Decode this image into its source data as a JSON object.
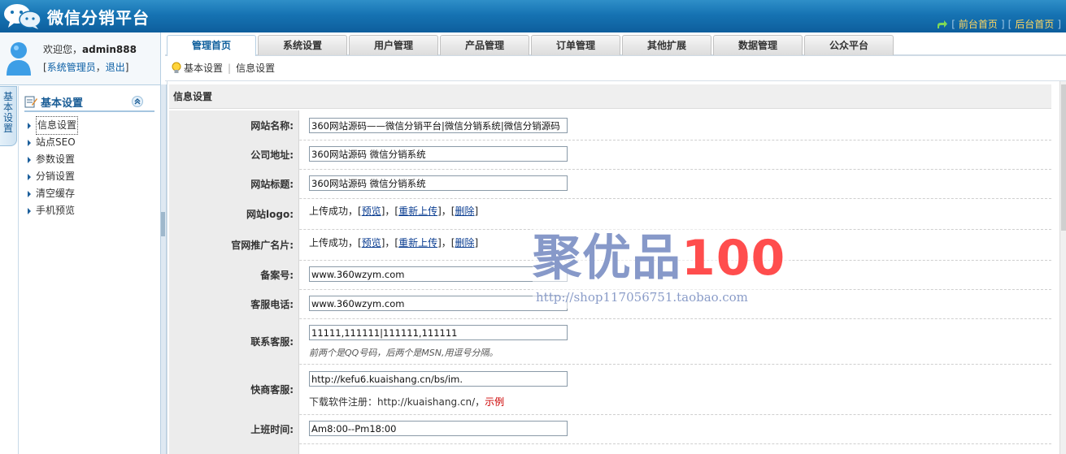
{
  "app": {
    "title": "微信分销平台"
  },
  "top_links": {
    "front": "前台首页",
    "back": "后台首页",
    "sep": "|"
  },
  "user": {
    "welcome_prefix": "欢迎您，",
    "username": "admin888",
    "role": "系统管理员",
    "logout": "退出"
  },
  "side_tab": {
    "label": "基本设置"
  },
  "menu": {
    "title": "基本设置",
    "items": [
      {
        "label": "信息设置",
        "active": true
      },
      {
        "label": "站点SEO"
      },
      {
        "label": "参数设置"
      },
      {
        "label": "分销设置"
      },
      {
        "label": "清空缓存"
      },
      {
        "label": "手机预览"
      }
    ]
  },
  "tabs": [
    "管理首页",
    "系统设置",
    "用户管理",
    "产品管理",
    "订单管理",
    "其他扩展",
    "数据管理",
    "公众平台"
  ],
  "breadcrumb": {
    "first": "基本设置",
    "second": "信息设置"
  },
  "section": {
    "title": "信息设置"
  },
  "form": {
    "site_name": {
      "label": "网站名称:",
      "value": "360网站源码——微信分销平台|微信分销系统|微信分销源码"
    },
    "company_address": {
      "label": "公司地址:",
      "value": "360网站源码 微信分销系统"
    },
    "site_title": {
      "label": "网站标题:",
      "value": "360网站源码 微信分销系统"
    },
    "site_logo": {
      "label": "网站logo:",
      "status": "上传成功，",
      "preview": "预览",
      "reupload": "重新上传",
      "delete": "删除"
    },
    "promo_card": {
      "label": "官网推广名片:",
      "status": "上传成功，",
      "preview": "预览",
      "reupload": "重新上传",
      "delete": "删除"
    },
    "icp": {
      "label": "备案号:",
      "value": "www.360wzym.com"
    },
    "service_phone": {
      "label": "客服电话:",
      "value": "www.360wzym.com"
    },
    "contact_service": {
      "label": "联系客服:",
      "value": "11111,111111|111111,111111",
      "note": "前两个是QQ号码，后两个是MSN,用逗号分隔。"
    },
    "kuaishang": {
      "label": "快商客服:",
      "value": "http://kefu6.kuaishang.cn/bs/im.",
      "hint": "下载软件注册：http://kuaishang.cn/，",
      "example": "示例"
    },
    "work_time": {
      "label": "上班时间:",
      "value": "Am8:00--Pm18:00"
    }
  },
  "watermark": {
    "title_cn": "聚优品",
    "title_num": "100",
    "url": "http://shop117056751.taobao.com"
  },
  "colors": {
    "header": "#1673b3",
    "accent": "#0d5e9c",
    "tab_active_text": "#0d5e9c"
  }
}
